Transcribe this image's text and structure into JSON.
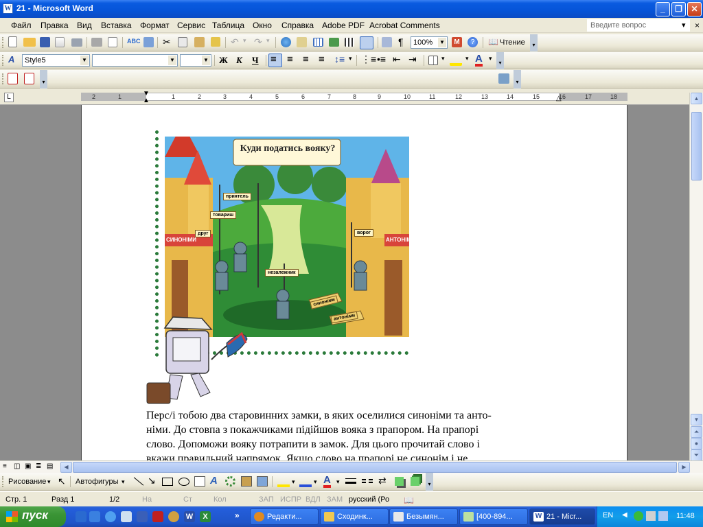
{
  "window": {
    "title": "21 - Microsoft Word"
  },
  "menu": {
    "items": [
      "Файл",
      "Правка",
      "Вид",
      "Вставка",
      "Формат",
      "Сервис",
      "Таблица",
      "Окно",
      "Справка",
      "Adobe PDF",
      "Acrobat Comments"
    ],
    "help_placeholder": "Введите вопрос"
  },
  "toolbar": {
    "zoom": "100%",
    "reading_label": "Чтение"
  },
  "formatting": {
    "style": "Style5",
    "font": "",
    "size": "",
    "bold": "Ж",
    "italic": "К",
    "underline": "Ч"
  },
  "ruler": {
    "labels": [
      "2",
      "1",
      "1",
      "2",
      "3",
      "4",
      "5",
      "6",
      "7",
      "8",
      "9",
      "10",
      "11",
      "12",
      "13",
      "14",
      "15",
      "16",
      "17",
      "18"
    ]
  },
  "document": {
    "picture": {
      "title": "Куди податись вояку?",
      "signs_left": [
        "приятель",
        "товариш",
        "друг"
      ],
      "sign_right": "ворог",
      "sign_center": "незалежник",
      "arrows": [
        "синоніми",
        "антоніми"
      ],
      "castle_left": "СИНОНІМИ",
      "castle_right": "АНТОНІМИ"
    },
    "paragraph_lines": [
      "Перс/і тобою два старовинних замки, в яких оселилися синоніми та анто-",
      "німи. До стовпа з покажчиками підійшов вояка з прапором. На прапорі",
      "слово. Допоможи вояку потрапити в замок. Для цього прочитай слово і",
      "вкажи правильний напрямок. Якщо слово на прапорі не синонім і не"
    ]
  },
  "drawing_toolbar": {
    "draw_label": "Рисование",
    "autoshapes_label": "Автофигуры"
  },
  "status": {
    "page": "Стр. 1",
    "section": "Разд 1",
    "pages": "1/2",
    "at": "На",
    "line": "Ст",
    "col": "Кол",
    "rec": "ЗАП",
    "trk": "ИСПР",
    "ext": "ВДЛ",
    "ovr": "ЗАМ",
    "language": "русский (Ро"
  },
  "taskbar": {
    "start_label": "пуск",
    "tasks": [
      "Редакти...",
      "Сходинк...",
      "Безымян...",
      "[400-894...",
      "21 - Micr..."
    ],
    "lang": "EN",
    "clock": "11:48"
  },
  "colors": {
    "titlebar": "#0654d8",
    "taskbar": "#245edb",
    "start": "#3a9435",
    "accent_red": "#c43d18"
  }
}
